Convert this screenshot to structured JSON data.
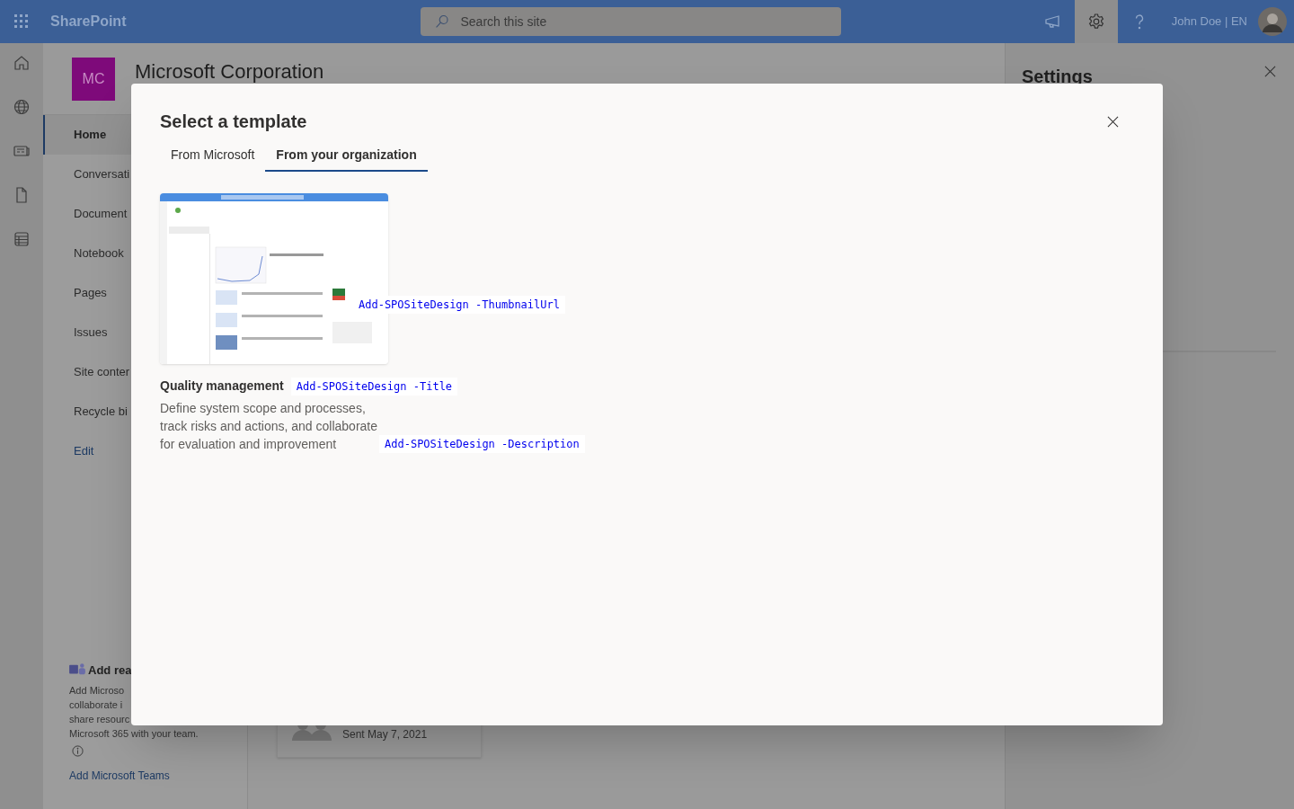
{
  "top_bar": {
    "app_name": "SharePoint",
    "search": {
      "placeholder": "Search this site"
    },
    "settings": {
      "selected": true
    },
    "user": "John Doe | EN"
  },
  "site": {
    "logo": "MC",
    "title": "Microsoft Corporation"
  },
  "nav": [
    {
      "label": "Home",
      "selected": true,
      "kind": "item"
    },
    {
      "label": "Conversati",
      "selected": false,
      "kind": "item"
    },
    {
      "label": "Document",
      "selected": false,
      "kind": "item"
    },
    {
      "label": "Notebook",
      "selected": false,
      "kind": "item"
    },
    {
      "label": "Pages",
      "selected": false,
      "kind": "item"
    },
    {
      "label": "Issues",
      "selected": false,
      "kind": "item"
    },
    {
      "label": "Site conter",
      "selected": false,
      "kind": "item"
    },
    {
      "label": "Recycle bi",
      "selected": false,
      "kind": "item"
    },
    {
      "label": "Edit",
      "selected": false,
      "kind": "link"
    }
  ],
  "teams_card": {
    "title": "Add rea",
    "text_lines": [
      "Add Microso",
      "collaborate i",
      "share resourc",
      "Microsoft 365 with your team."
    ],
    "link": "Add Microsoft Teams"
  },
  "activity_card": {
    "sent": "Sent May 7, 2021"
  },
  "settings_panel": {
    "title": "Settings"
  },
  "dialog": {
    "title": "Select a template",
    "tabs": [
      {
        "label": "From Microsoft",
        "selected": false
      },
      {
        "label": "From your organization",
        "selected": true
      }
    ],
    "template": {
      "title": "Quality management",
      "description_lines": [
        "Define system scope and processes,",
        "track risks and actions, and collaborate",
        "for evaluation and improvement"
      ],
      "annotations": {
        "thumbnail": "Add-SPOSiteDesign -ThumbnailUrl",
        "title": "Add-SPOSiteDesign -Title",
        "description": "Add-SPOSiteDesign -Description"
      }
    }
  }
}
